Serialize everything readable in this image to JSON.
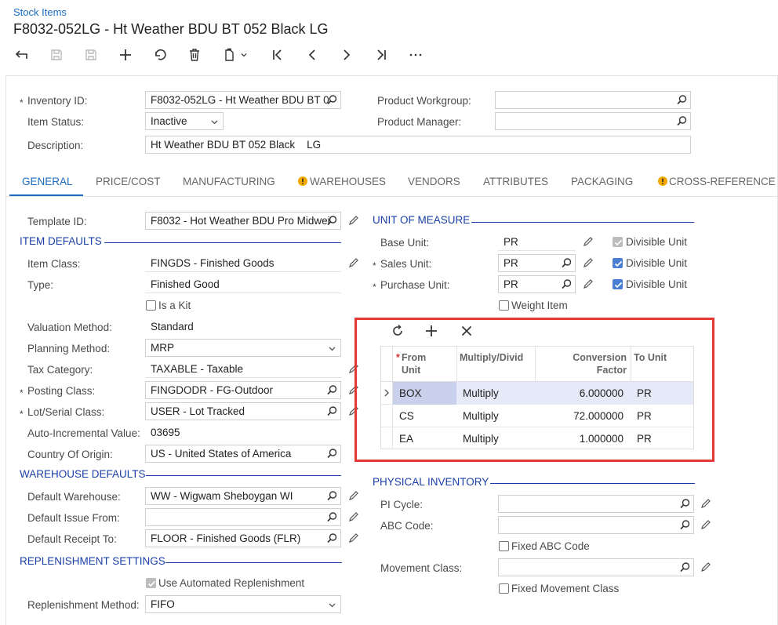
{
  "breadcrumb": "Stock Items",
  "title": "F8032-052LG - Ht Weather BDU BT 052 Black LG",
  "header": {
    "inventory_id_label": "Inventory ID:",
    "inventory_id": "F8032-052LG - Ht Weather BDU BT 0",
    "item_status_label": "Item Status:",
    "item_status": "Inactive",
    "description_label": "Description:",
    "description": "Ht Weather BDU BT 052 Black    LG",
    "product_workgroup_label": "Product Workgroup:",
    "product_workgroup": "",
    "product_manager_label": "Product Manager:",
    "product_manager": ""
  },
  "tabs": [
    "GENERAL",
    "PRICE/COST",
    "MANUFACTURING",
    "WAREHOUSES",
    "VENDORS",
    "ATTRIBUTES",
    "PACKAGING",
    "CROSS-REFERENCE"
  ],
  "general": {
    "template_id_label": "Template ID:",
    "template_id": "F8032 - Hot Weather BDU Pro Midwei",
    "item_defaults_title": "ITEM DEFAULTS",
    "item_class_label": "Item Class:",
    "item_class": "FINGDS - Finished Goods",
    "type_label": "Type:",
    "type": "Finished Good",
    "is_kit_label": "Is a Kit",
    "valuation_label": "Valuation Method:",
    "valuation": "Standard",
    "planning_label": "Planning Method:",
    "planning": "MRP",
    "tax_label": "Tax Category:",
    "tax": "TAXABLE - Taxable",
    "posting_label": "Posting Class:",
    "posting": "FINGDODR - FG-Outdoor",
    "lot_label": "Lot/Serial Class:",
    "lot": "USER - Lot Tracked",
    "auto_inc_label": "Auto-Incremental Value:",
    "auto_inc": "03695",
    "country_label": "Country Of Origin:",
    "country": "US - United States of America",
    "warehouse_defaults_title": "WAREHOUSE DEFAULTS",
    "def_wh_label": "Default Warehouse:",
    "def_wh": "WW - Wigwam Sheboygan WI",
    "def_issue_label": "Default Issue From:",
    "def_issue": "",
    "def_receipt_label": "Default Receipt To:",
    "def_receipt": "FLOOR - Finished Goods (FLR)",
    "replenishment_title": "REPLENISHMENT SETTINGS",
    "use_auto_label": "Use Automated Replenishment",
    "repl_method_label": "Replenishment Method:",
    "repl_method": "FIFO"
  },
  "uom": {
    "title": "UNIT OF MEASURE",
    "base_label": "Base Unit:",
    "base": "PR",
    "sales_label": "Sales Unit:",
    "sales": "PR",
    "purchase_label": "Purchase Unit:",
    "purchase": "PR",
    "divisible_label": "Divisible Unit",
    "weight_item_label": "Weight Item",
    "grid": {
      "col_from": "From Unit",
      "col_from_1": "From",
      "col_from_2": "Unit",
      "col_mult": "Multiply/Divid",
      "col_conv_1": "Conversion",
      "col_conv_2": "Factor",
      "col_to": "To Unit",
      "rows": [
        {
          "from": "BOX",
          "mult": "Multiply",
          "conv": "6.000000",
          "to": "PR"
        },
        {
          "from": "CS",
          "mult": "Multiply",
          "conv": "72.000000",
          "to": "PR"
        },
        {
          "from": "EA",
          "mult": "Multiply",
          "conv": "1.000000",
          "to": "PR"
        }
      ]
    }
  },
  "physical": {
    "title": "PHYSICAL INVENTORY",
    "pi_cycle_label": "PI Cycle:",
    "pi_cycle": "",
    "abc_label": "ABC Code:",
    "abc": "",
    "fixed_abc_label": "Fixed ABC Code",
    "movement_label": "Movement Class:",
    "movement": "",
    "fixed_movement_label": "Fixed Movement Class"
  },
  "colors": {
    "accent": "#1a6cc2",
    "section": "#1a3fa6",
    "highlight": "#e53935",
    "selected_row": "#e6e9f7",
    "warning": "#f2a900"
  }
}
